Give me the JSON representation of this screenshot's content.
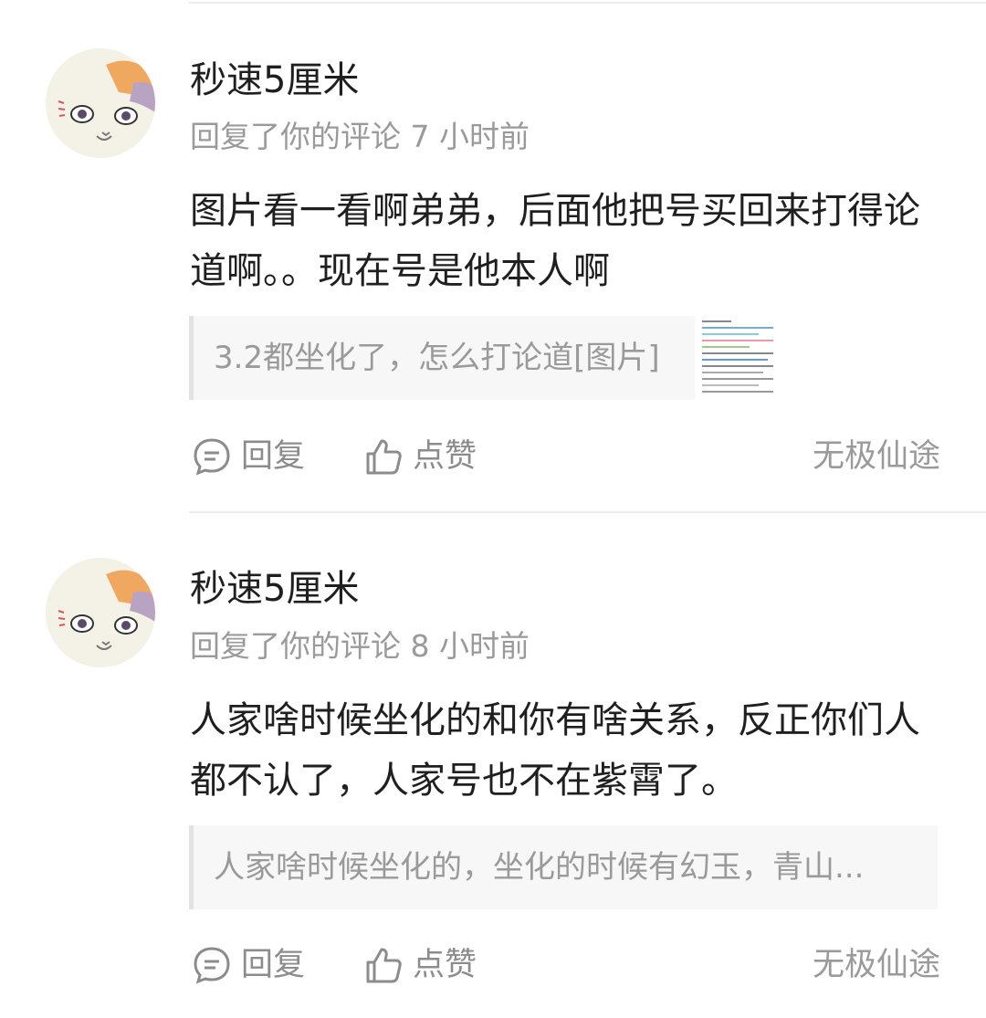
{
  "comments": [
    {
      "username": "秒速5厘米",
      "meta": "回复了你的评论 7 小时前",
      "body": "图片看一看啊弟弟，后面他把号买回来打得论道啊。。现在号是他本人啊",
      "quote": "3.2都坐化了，怎么打论道[图片]",
      "reply_label": "回复",
      "like_label": "点赞",
      "source": "无极仙途"
    },
    {
      "username": "秒速5厘米",
      "meta": "回复了你的评论 8 小时前",
      "body": "人家啥时候坐化的和你有啥关系，反正你们人都不认了，人家号也不在紫霄了。",
      "quote": "人家啥时候坐化的，坐化的时候有幻玉，青山...",
      "reply_label": "回复",
      "like_label": "点赞",
      "source": "无极仙途"
    }
  ],
  "icons": {
    "reply": "comment-bubble-icon",
    "like": "thumbs-up-icon",
    "avatar": "cat-face-avatar"
  },
  "colors": {
    "text": "#1f1f1f",
    "muted": "#9a9a9a",
    "quote_bg": "#f7f7f7"
  }
}
